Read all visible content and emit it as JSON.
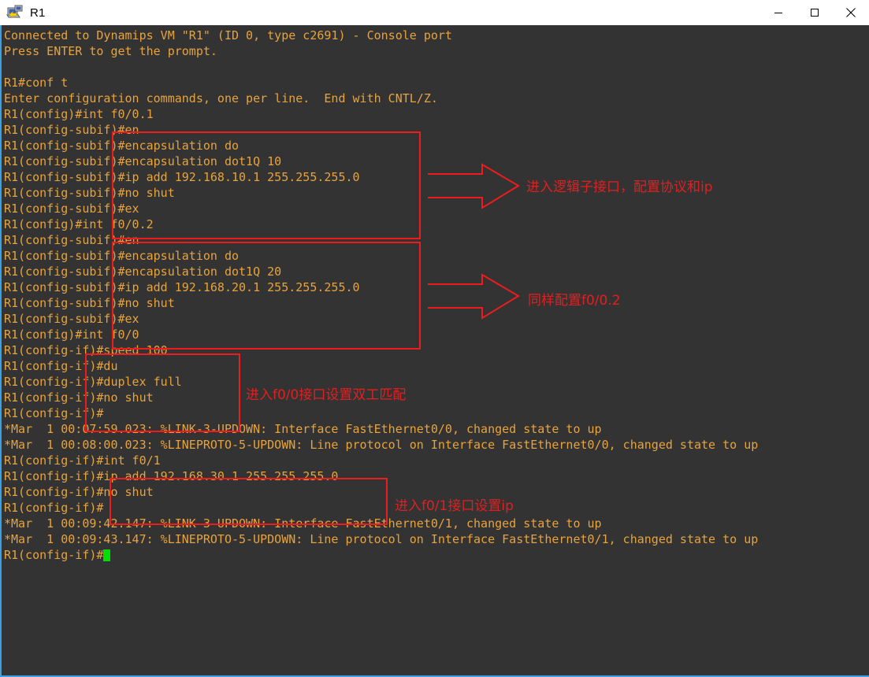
{
  "window": {
    "title": "R1",
    "icon": "console-terminal-icon",
    "controls": {
      "minimize": "minimize-icon",
      "maximize": "maximize-icon",
      "close": "close-icon"
    }
  },
  "colors": {
    "terminal_background": "#333333",
    "terminal_text": "#e8a33d",
    "annotation": "#e02020",
    "cursor": "#00e000",
    "window_border": "#3c9fe0"
  },
  "terminal": {
    "lines": [
      "Connected to Dynamips VM \"R1\" (ID 0, type c2691) - Console port",
      "Press ENTER to get the prompt.",
      "",
      "R1#conf t",
      "Enter configuration commands, one per line.  End with CNTL/Z.",
      "R1(config)#int f0/0.1",
      "R1(config-subif)#en",
      "R1(config-subif)#encapsulation do",
      "R1(config-subif)#encapsulation dot1Q 10",
      "R1(config-subif)#ip add 192.168.10.1 255.255.255.0",
      "R1(config-subif)#no shut",
      "R1(config-subif)#ex",
      "R1(config)#int f0/0.2",
      "R1(config-subif)#en",
      "R1(config-subif)#encapsulation do",
      "R1(config-subif)#encapsulation dot1Q 20",
      "R1(config-subif)#ip add 192.168.20.1 255.255.255.0",
      "R1(config-subif)#no shut",
      "R1(config-subif)#ex",
      "R1(config)#int f0/0",
      "R1(config-if)#speed 100",
      "R1(config-if)#du",
      "R1(config-if)#duplex full",
      "R1(config-if)#no shut",
      "R1(config-if)#",
      "*Mar  1 00:07:59.023: %LINK-3-UPDOWN: Interface FastEthernet0/0, changed state to up",
      "*Mar  1 00:08:00.023: %LINEPROTO-5-UPDOWN: Line protocol on Interface FastEthernet0/0, changed state to up",
      "R1(config-if)#int f0/1",
      "R1(config-if)#ip add 192.168.30.1 255.255.255.0",
      "R1(config-if)#no shut",
      "R1(config-if)#",
      "*Mar  1 00:09:42.147: %LINK-3-UPDOWN: Interface FastEthernet0/1, changed state to up",
      "*Mar  1 00:09:43.147: %LINEPROTO-5-UPDOWN: Line protocol on Interface FastEthernet0/1, changed state to up"
    ],
    "prompt_line": "R1(config-if)#"
  },
  "annotations": [
    {
      "id": "subinterface-f0-0-1",
      "text": "进入逻辑子接口，配置协议和ip",
      "arrow": true
    },
    {
      "id": "subinterface-f0-0-2",
      "text": "同样配置f0/0.2",
      "arrow": true
    },
    {
      "id": "interface-f0-0-duplex",
      "text": "进入f0/0接口设置双工匹配",
      "arrow": false
    },
    {
      "id": "interface-f0-1-ip",
      "text": "进入f0/1接口设置ip",
      "arrow": false
    }
  ]
}
